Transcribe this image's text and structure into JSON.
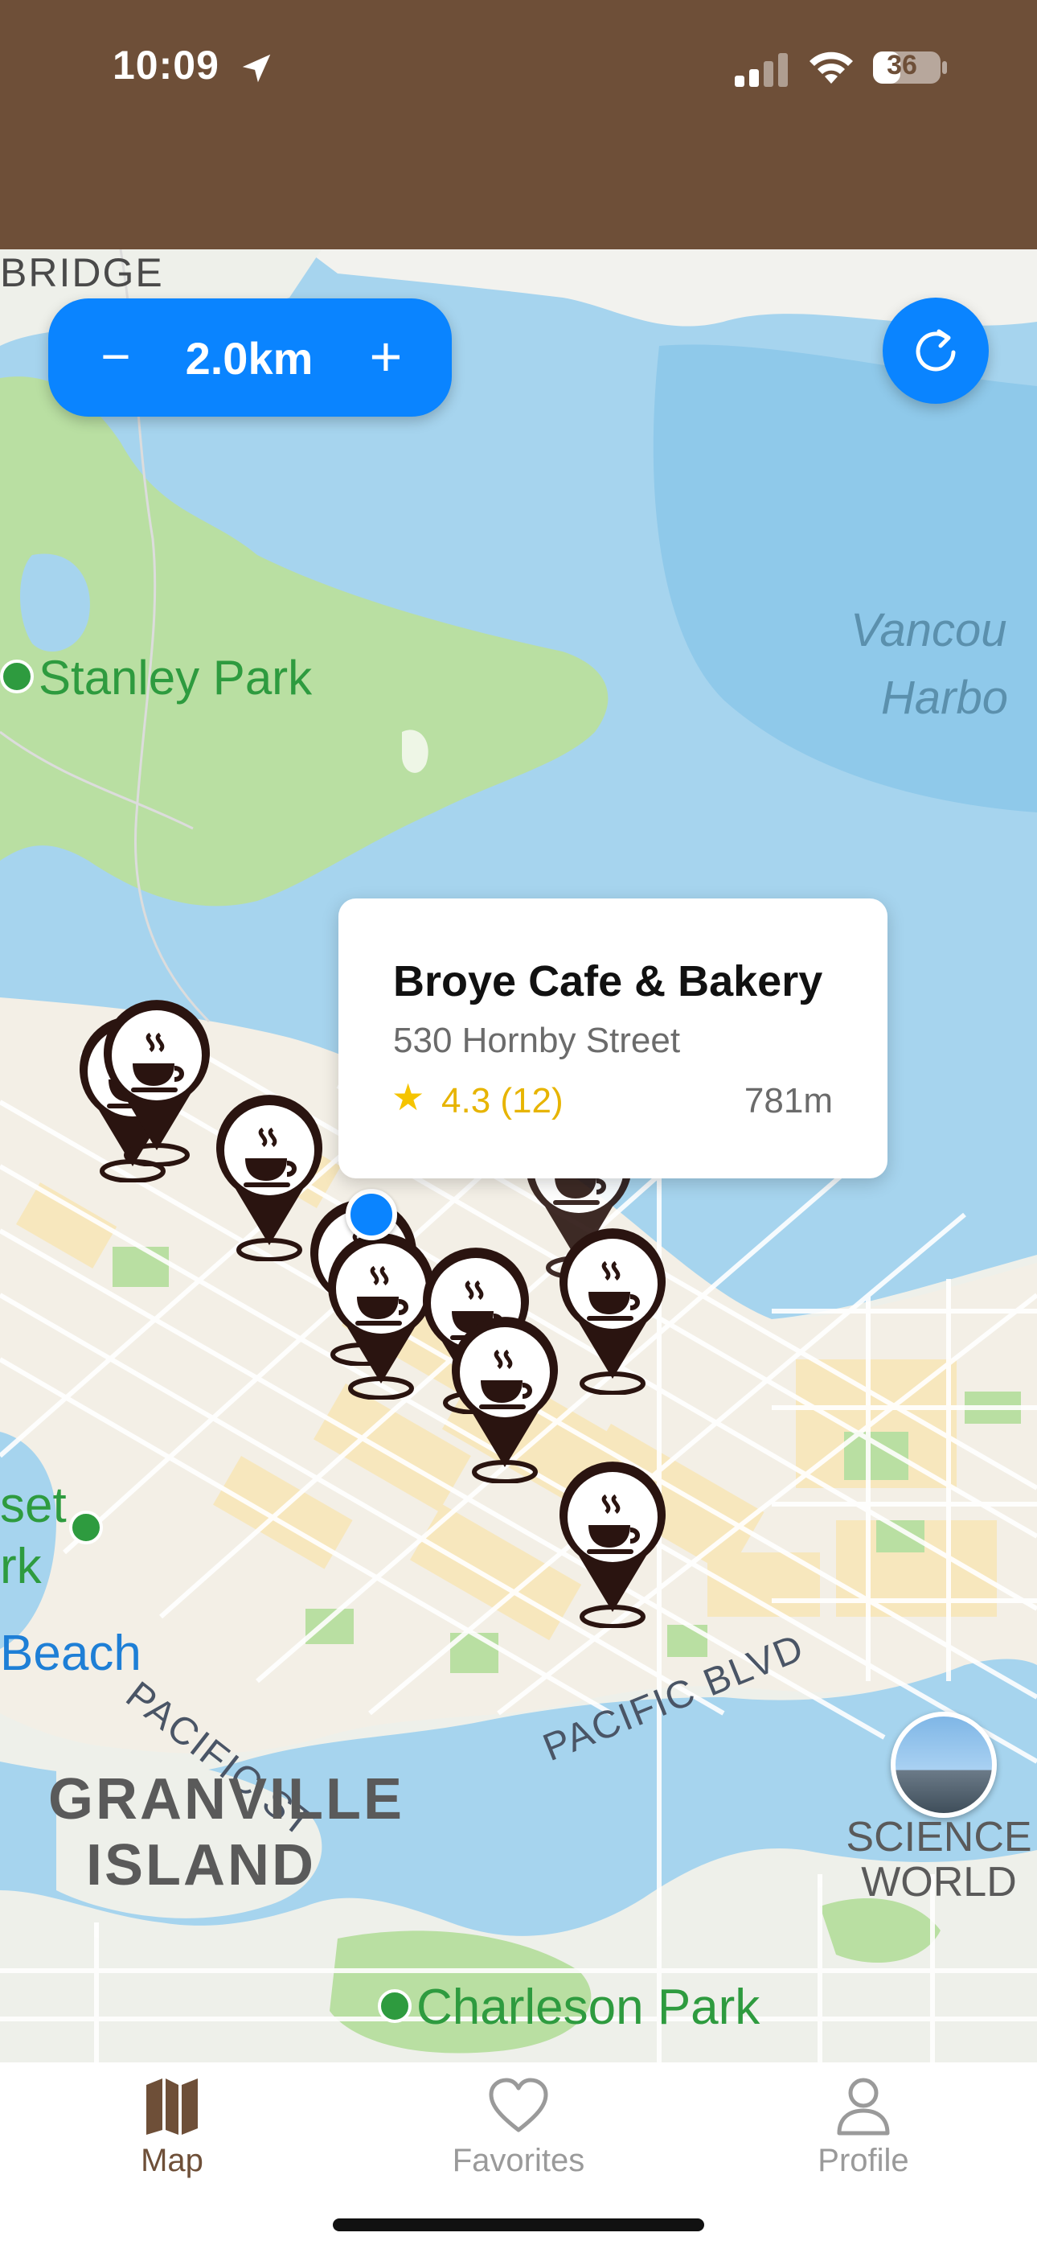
{
  "status_bar": {
    "time": "10:09",
    "battery": "36"
  },
  "map": {
    "labels": {
      "bridge": "BRIDGE",
      "stanley_park": "Stanley Park",
      "vancouver_harbour_1": "Vancou",
      "vancouver_harbour_2": "Harbo",
      "sunset_beach_park_1": "set",
      "sunset_beach_park_2": "rk",
      "beach": "Beach",
      "pacific_st": "PACIFIC ST",
      "pacific_blvd": "PACIFIC BLVD",
      "granville_island_1": "GRANVILLE",
      "granville_island_2": "ISLAND",
      "science_world_1": "SCIENCE",
      "science_world_2": "WORLD",
      "charleson_park": "Charleson Park"
    },
    "cafe_pin_count": 11
  },
  "zoom_control": {
    "minus": "−",
    "radius": "2.0km",
    "plus": "+"
  },
  "popup": {
    "name": "Broye Cafe & Bakery",
    "address": "530 Hornby Street",
    "star": "★",
    "rating": "4.3 (12)",
    "distance": "781m"
  },
  "tabs": [
    {
      "label": "Map",
      "icon": "map-icon",
      "active": true
    },
    {
      "label": "Favorites",
      "icon": "heart-icon",
      "active": false
    },
    {
      "label": "Profile",
      "icon": "person-icon",
      "active": false
    }
  ],
  "colors": {
    "header": "#6e4f38",
    "accent": "#0a84ff",
    "pin": "#2a1410",
    "water": "#a6d4ee",
    "park": "#b9dfa2",
    "tab_active": "#6e4f38",
    "tab_inactive": "#9a9a9a"
  }
}
